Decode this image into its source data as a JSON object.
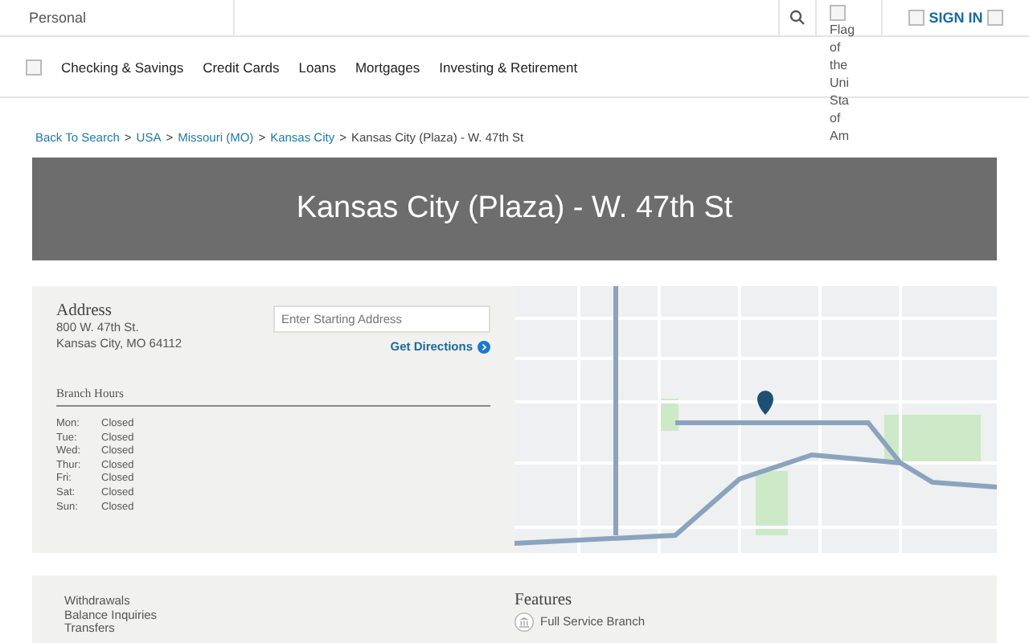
{
  "top_bar": {
    "segment": "Personal",
    "flag_alt_lines": [
      "Flag",
      "of",
      "the",
      "Uni",
      "Sta",
      "of",
      "Am"
    ],
    "sign_in": "SIGN IN"
  },
  "nav": {
    "items": [
      "Checking & Savings",
      "Credit Cards",
      "Loans",
      "Mortgages",
      "Investing & Retirement"
    ]
  },
  "breadcrumb": {
    "links": [
      "Back To Search",
      "USA",
      "Missouri (MO)",
      "Kansas City"
    ],
    "current": "Kansas City (Plaza) - W. 47th St",
    "separator": ">"
  },
  "banner": {
    "title": "Kansas City (Plaza) - W. 47th St"
  },
  "branch": {
    "address_heading": "Address",
    "address_lines": [
      "800 W. 47th St.",
      "Kansas City, MO 64112"
    ],
    "start_field": {
      "placeholder": "Enter Starting Address"
    },
    "directions": "Get Directions",
    "hours_heading": "Branch Hours",
    "hours": [
      {
        "day": "Mon:",
        "status": "Closed"
      },
      {
        "day": "Tue:",
        "status": "Closed"
      },
      {
        "day": "Wed:",
        "status": "Closed"
      },
      {
        "day": "Thur:",
        "status": "Closed"
      },
      {
        "day": "Fri:",
        "status": "Closed"
      },
      {
        "day": "Sat:",
        "status": "Closed"
      },
      {
        "day": "Sun:",
        "status": "Closed"
      }
    ]
  },
  "services": {
    "items": [
      "Withdrawals",
      "Balance Inquiries",
      "Transfers"
    ],
    "features_heading": "Features",
    "features": [
      "Full Service Branch"
    ]
  }
}
